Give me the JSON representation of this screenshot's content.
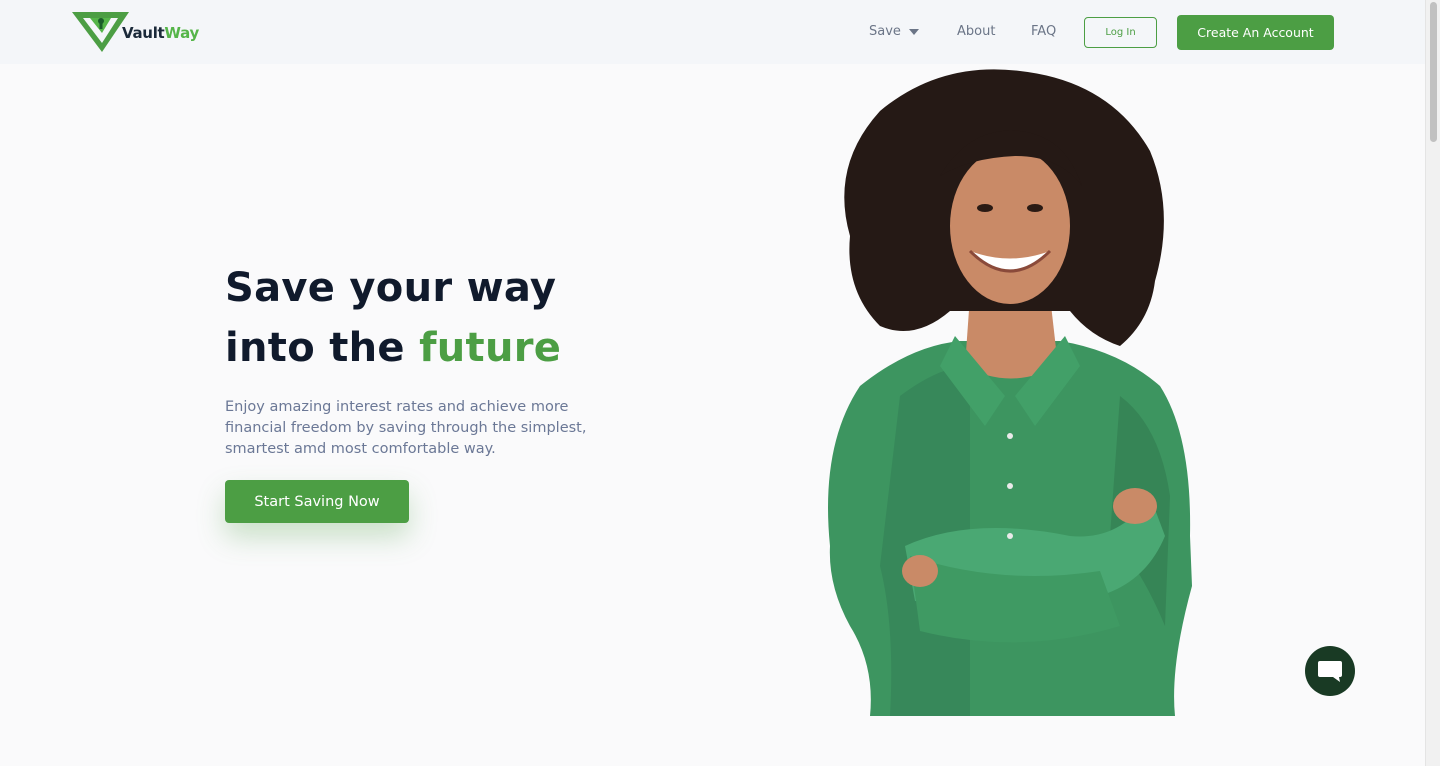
{
  "brand": {
    "name_part1": "Vault",
    "name_part2": "Way",
    "primary_color": "#4c9e44",
    "dark_color": "#101a2c"
  },
  "nav": {
    "save_label": "Save",
    "about_label": "About",
    "faq_label": "FAQ",
    "login_label": "Log In",
    "create_account_label": "Create An Account"
  },
  "hero": {
    "title_line1": "Save your way",
    "title_line2_prefix": "into the ",
    "title_line2_accent": "future",
    "subtitle": "Enjoy amazing interest rates and achieve more financial freedom by saving through the simplest, smartest amd most comfortable way.",
    "cta_label": "Start Saving Now"
  },
  "icons": {
    "logo": "vaultway-logo-icon",
    "dropdown": "chevron-down-icon",
    "chat": "chat-bubble-icon"
  }
}
